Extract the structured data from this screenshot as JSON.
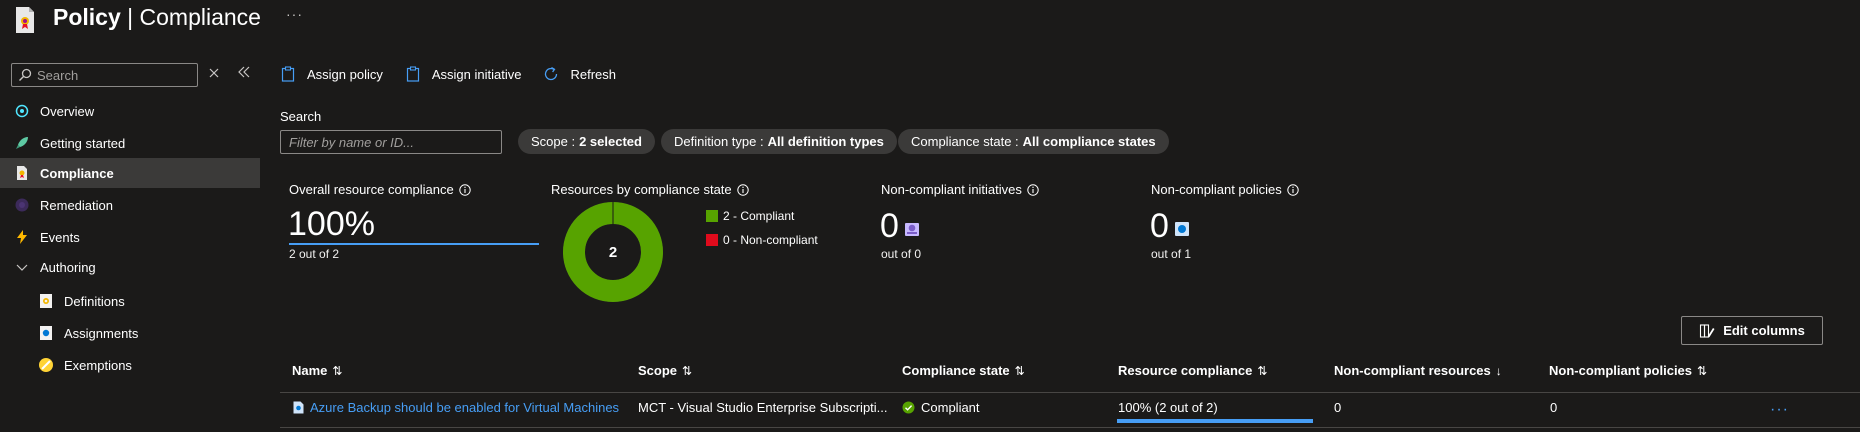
{
  "header": {
    "title_bold": "Policy",
    "title_sep": " | ",
    "title_rest": "Compliance",
    "more": "···"
  },
  "sidebar": {
    "search_placeholder": "Search",
    "items": [
      {
        "label": "Overview",
        "icon": "overview-icon"
      },
      {
        "label": "Getting started",
        "icon": "rocket-icon"
      },
      {
        "label": "Compliance",
        "icon": "compliance-icon",
        "active": true
      },
      {
        "label": "Remediation",
        "icon": "remediation-icon"
      },
      {
        "label": "Events",
        "icon": "lightning-icon"
      },
      {
        "label": "Authoring",
        "icon": "chevron-down-icon"
      },
      {
        "label": "Definitions",
        "icon": "definitions-icon"
      },
      {
        "label": "Assignments",
        "icon": "assignments-icon"
      },
      {
        "label": "Exemptions",
        "icon": "exemptions-icon"
      }
    ]
  },
  "toolbar": {
    "assign_policy": "Assign policy",
    "assign_initiative": "Assign initiative",
    "refresh": "Refresh"
  },
  "filters": {
    "search_label": "Search",
    "search_placeholder": "Filter by name or ID...",
    "scope_label": "Scope :",
    "scope_value": "2 selected",
    "deftype_label": "Definition type :",
    "deftype_value": "All definition types",
    "state_label": "Compliance state :",
    "state_value": "All compliance states"
  },
  "summary": {
    "overall_title": "Overall resource compliance",
    "overall_value": "100%",
    "overall_sub": "2 out of 2",
    "by_state_title": "Resources by compliance state",
    "donut_center": "2",
    "legend_compliant": "2 - Compliant",
    "legend_noncompliant": "0 - Non-compliant",
    "initiatives_title": "Non-compliant initiatives",
    "initiatives_value": "0",
    "initiatives_sub": "out of 0",
    "policies_title": "Non-compliant policies",
    "policies_value": "0",
    "policies_sub": "out of 1"
  },
  "chart_data": {
    "type": "pie",
    "categories": [
      "Compliant",
      "Non-compliant"
    ],
    "values": [
      2,
      0
    ],
    "colors": [
      "#57a300",
      "#e00b1c"
    ]
  },
  "edit_columns": "Edit columns",
  "table": {
    "columns": [
      "Name",
      "Scope",
      "Compliance state",
      "Resource compliance",
      "Non-compliant resources",
      "Non-compliant policies"
    ],
    "sort_marks": [
      "⇅",
      "⇅",
      "⇅",
      "⇅",
      "↓",
      "⇅"
    ],
    "rows": [
      {
        "name": "Azure Backup should be enabled for Virtual Machines",
        "scope": "MCT - Visual Studio Enterprise Subscripti...",
        "state": "Compliant",
        "resource_compliance": "100% (2 out of 2)",
        "resource_compliance_fraction": 1.0,
        "noncompliant_resources": "0",
        "noncompliant_policies": "0",
        "more": "···"
      }
    ]
  },
  "colors": {
    "accent": "#479ef5",
    "compliant": "#57a300",
    "noncompliant": "#e00b1c",
    "background": "#1b1a19",
    "pill": "#3b3a39"
  }
}
